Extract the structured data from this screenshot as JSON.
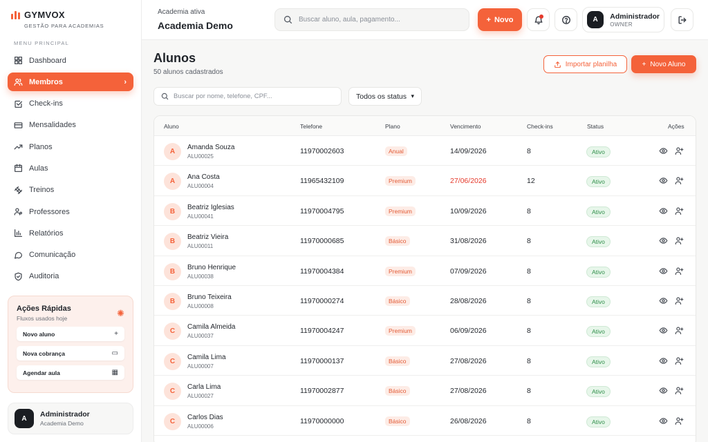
{
  "brand": {
    "name": "GYMVOX",
    "tagline": "GESTÃO PARA ACADEMIAS"
  },
  "sidebar": {
    "menu_title": "MENU PRINCIPAL",
    "items": [
      {
        "label": "Dashboard",
        "icon": "grid-icon",
        "active": false
      },
      {
        "label": "Membros",
        "icon": "users-icon",
        "active": true
      },
      {
        "label": "Check-ins",
        "icon": "check-square-icon",
        "active": false
      },
      {
        "label": "Mensalidades",
        "icon": "credit-card-icon",
        "active": false
      },
      {
        "label": "Planos",
        "icon": "trend-icon",
        "active": false
      },
      {
        "label": "Aulas",
        "icon": "calendar-icon",
        "active": false
      },
      {
        "label": "Treinos",
        "icon": "dumbbell-icon",
        "active": false
      },
      {
        "label": "Professores",
        "icon": "user-badge-icon",
        "active": false
      },
      {
        "label": "Relatórios",
        "icon": "bar-chart-icon",
        "active": false
      },
      {
        "label": "Comunicação",
        "icon": "message-icon",
        "active": false
      },
      {
        "label": "Auditoria",
        "icon": "shield-icon",
        "active": false
      }
    ],
    "quick_actions": {
      "title": "Ações Rápidas",
      "subtitle": "Fluxos usados hoje",
      "items": [
        {
          "label": "Novo aluno",
          "icon": "plus-icon"
        },
        {
          "label": "Nova cobrança",
          "icon": "card-icon"
        },
        {
          "label": "Agendar aula",
          "icon": "calendar-icon"
        }
      ]
    },
    "user": {
      "initial": "A",
      "name": "Administrador",
      "org": "Academia Demo"
    }
  },
  "header": {
    "org_label": "Academia ativa",
    "org_name": "Academia Demo",
    "search_placeholder": "Buscar aluno, aula, pagamento...",
    "new_button": "Novo",
    "user": {
      "initial": "A",
      "name": "Administrador",
      "role": "OWNER"
    }
  },
  "page": {
    "title": "Alunos",
    "subtitle": "50 alunos cadastrados",
    "import_button": "Importar planilha",
    "new_student_button": "Novo Aluno",
    "filter_placeholder": "Buscar por nome, telefone, CPF...",
    "status_filter": "Todos os status"
  },
  "table": {
    "columns": [
      "Aluno",
      "Telefone",
      "Plano",
      "Vencimento",
      "Check-ins",
      "Status",
      "Ações"
    ],
    "rows": [
      {
        "initial": "A",
        "name": "Amanda Souza",
        "code": "ALU00025",
        "phone": "11970002603",
        "plan": "Anual",
        "due": "14/09/2026",
        "late": false,
        "checkins": "8",
        "status": "Ativo"
      },
      {
        "initial": "A",
        "name": "Ana Costa",
        "code": "ALU00004",
        "phone": "11965432109",
        "plan": "Premium",
        "due": "27/06/2026",
        "late": true,
        "checkins": "12",
        "status": "Ativo"
      },
      {
        "initial": "B",
        "name": "Beatriz Iglesias",
        "code": "ALU00041",
        "phone": "11970004795",
        "plan": "Premium",
        "due": "10/09/2026",
        "late": false,
        "checkins": "8",
        "status": "Ativo"
      },
      {
        "initial": "B",
        "name": "Beatriz Vieira",
        "code": "ALU00011",
        "phone": "11970000685",
        "plan": "Básico",
        "due": "31/08/2026",
        "late": false,
        "checkins": "8",
        "status": "Ativo"
      },
      {
        "initial": "B",
        "name": "Bruno Henrique",
        "code": "ALU00038",
        "phone": "11970004384",
        "plan": "Premium",
        "due": "07/09/2026",
        "late": false,
        "checkins": "8",
        "status": "Ativo"
      },
      {
        "initial": "B",
        "name": "Bruno Teixeira",
        "code": "ALU00008",
        "phone": "11970000274",
        "plan": "Básico",
        "due": "28/08/2026",
        "late": false,
        "checkins": "8",
        "status": "Ativo"
      },
      {
        "initial": "C",
        "name": "Camila Almeida",
        "code": "ALU00037",
        "phone": "11970004247",
        "plan": "Premium",
        "due": "06/09/2026",
        "late": false,
        "checkins": "8",
        "status": "Ativo"
      },
      {
        "initial": "C",
        "name": "Camila Lima",
        "code": "ALU00007",
        "phone": "11970000137",
        "plan": "Básico",
        "due": "27/08/2026",
        "late": false,
        "checkins": "8",
        "status": "Ativo"
      },
      {
        "initial": "C",
        "name": "Carla Lima",
        "code": "ALU00027",
        "phone": "11970002877",
        "plan": "Básico",
        "due": "27/08/2026",
        "late": false,
        "checkins": "8",
        "status": "Ativo"
      },
      {
        "initial": "C",
        "name": "Carlos Dias",
        "code": "ALU00006",
        "phone": "11970000000",
        "plan": "Básico",
        "due": "26/08/2026",
        "late": false,
        "checkins": "8",
        "status": "Ativo"
      }
    ]
  },
  "colors": {
    "accent": "#f4623a",
    "danger": "#e5392b",
    "success": "#2f8f4a"
  }
}
